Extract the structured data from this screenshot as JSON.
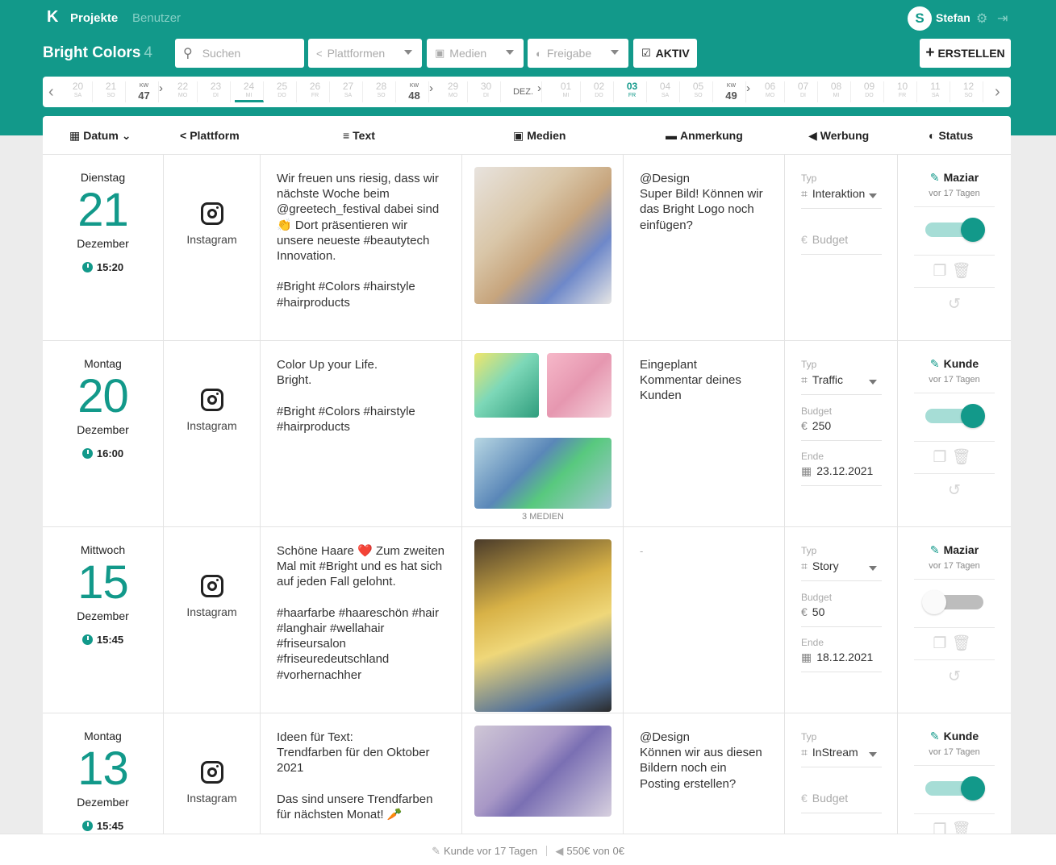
{
  "colors": {
    "brand": "#12998a",
    "brand_light": "#a6ddd6"
  },
  "nav": {
    "logo": "K",
    "projekte": "Projekte",
    "benutzer": "Benutzer"
  },
  "user": {
    "initial": "S",
    "name": "Stefan"
  },
  "project": {
    "title": "Bright Colors",
    "count": "4"
  },
  "filters": {
    "search_placeholder": "Suchen",
    "plattformen": "Plattformen",
    "medien": "Medien",
    "freigabe": "Freigabe",
    "aktiv": "AKTIV"
  },
  "create_label": "ERSTELLEN",
  "datestrip": [
    {
      "d": "20",
      "w": "SA"
    },
    {
      "d": "21",
      "w": "SO"
    },
    {
      "kw": "KW",
      "d": "47"
    },
    {
      "d": "22",
      "w": "MO"
    },
    {
      "d": "23",
      "w": "DI"
    },
    {
      "d": "24",
      "w": "MI"
    },
    {
      "d": "25",
      "w": "DO"
    },
    {
      "d": "26",
      "w": "FR"
    },
    {
      "d": "27",
      "w": "SA"
    },
    {
      "d": "28",
      "w": "SO"
    },
    {
      "kw": "KW",
      "d": "48"
    },
    {
      "d": "29",
      "w": "MO"
    },
    {
      "d": "30",
      "w": "DI"
    },
    {
      "month": "DEZ."
    },
    {
      "d": "01",
      "w": "MI"
    },
    {
      "d": "02",
      "w": "DO"
    },
    {
      "d": "03",
      "w": "FR"
    },
    {
      "d": "04",
      "w": "SA"
    },
    {
      "d": "05",
      "w": "SO"
    },
    {
      "kw": "KW",
      "d": "49"
    },
    {
      "d": "06",
      "w": "MO"
    },
    {
      "d": "07",
      "w": "DI"
    },
    {
      "d": "08",
      "w": "MI"
    },
    {
      "d": "09",
      "w": "DO"
    },
    {
      "d": "10",
      "w": "FR"
    },
    {
      "d": "11",
      "w": "SA"
    },
    {
      "d": "12",
      "w": "SO"
    }
  ],
  "columns": {
    "datum": "Datum",
    "plattform": "Plattform",
    "text": "Text",
    "medien": "Medien",
    "anmerkung": "Anmerkung",
    "werbung": "Werbung",
    "status": "Status"
  },
  "rows": [
    {
      "weekday": "Dienstag",
      "day": "21",
      "month": "Dezember",
      "time": "15:20",
      "platform": "Instagram",
      "text": "Wir freuen uns riesig, dass wir nächste Woche beim @greetech_festival dabei sind 👏 Dort präsentieren wir unsere neueste #beautytech Innovation.\n\n#Bright #Colors #hairstyle #hairproducts",
      "note": "@Design\nSuper Bild! Können wir das Bright Logo noch einfügen?",
      "ad_type_label": "Typ",
      "ad_type": "Interaktion",
      "budget_label": "Budget",
      "budget": "",
      "status_user": "Maziar",
      "status_ago": "vor 17 Tagen",
      "active": true
    },
    {
      "weekday": "Montag",
      "day": "20",
      "month": "Dezember",
      "time": "16:00",
      "platform": "Instagram",
      "text": "Color Up your Life.\nBright.\n\n#Bright #Colors #hairstyle #hairproducts",
      "note": "Eingeplant\nKommentar deines Kunden",
      "media_count": "3 MEDIEN",
      "ad_type_label": "Typ",
      "ad_type": "Traffic",
      "budget_label": "Budget",
      "budget": "250",
      "end_label": "Ende",
      "end": "23.12.2021",
      "status_user": "Kunde",
      "status_ago": "vor 17 Tagen",
      "active": true
    },
    {
      "weekday": "Mittwoch",
      "day": "15",
      "month": "Dezember",
      "time": "15:45",
      "platform": "Instagram",
      "text": "Schöne Haare ❤️ Zum zweiten Mal mit #Bright und es hat sich auf jeden Fall gelohnt.\n\n#haarfarbe #haareschön #hair #langhair #wellahair #friseursalon #friseuredeutschland #vorhernachher",
      "note": "-",
      "ad_type_label": "Typ",
      "ad_type": "Story",
      "budget_label": "Budget",
      "budget": "50",
      "end_label": "Ende",
      "end": "18.12.2021",
      "status_user": "Maziar",
      "status_ago": "vor 17 Tagen",
      "active": false
    },
    {
      "weekday": "Montag",
      "day": "13",
      "month": "Dezember",
      "time": "15:45",
      "platform": "Instagram",
      "text": "Ideen für Text:\nTrendfarben für den Oktober 2021\n\nDas sind unsere Trendfarben für nächsten Monat! 🥕",
      "note": "@Design\nKönnen wir aus diesen Bildern noch ein Posting erstellen?",
      "ad_type_label": "Typ",
      "ad_type": "InStream",
      "budget_label": "Budget",
      "budget": "",
      "status_user": "Kunde",
      "status_ago": "vor 17 Tagen",
      "active": true
    }
  ],
  "footer": {
    "last_edit": "Kunde vor 17 Tagen",
    "budget_summary": "550€ von 0€"
  }
}
